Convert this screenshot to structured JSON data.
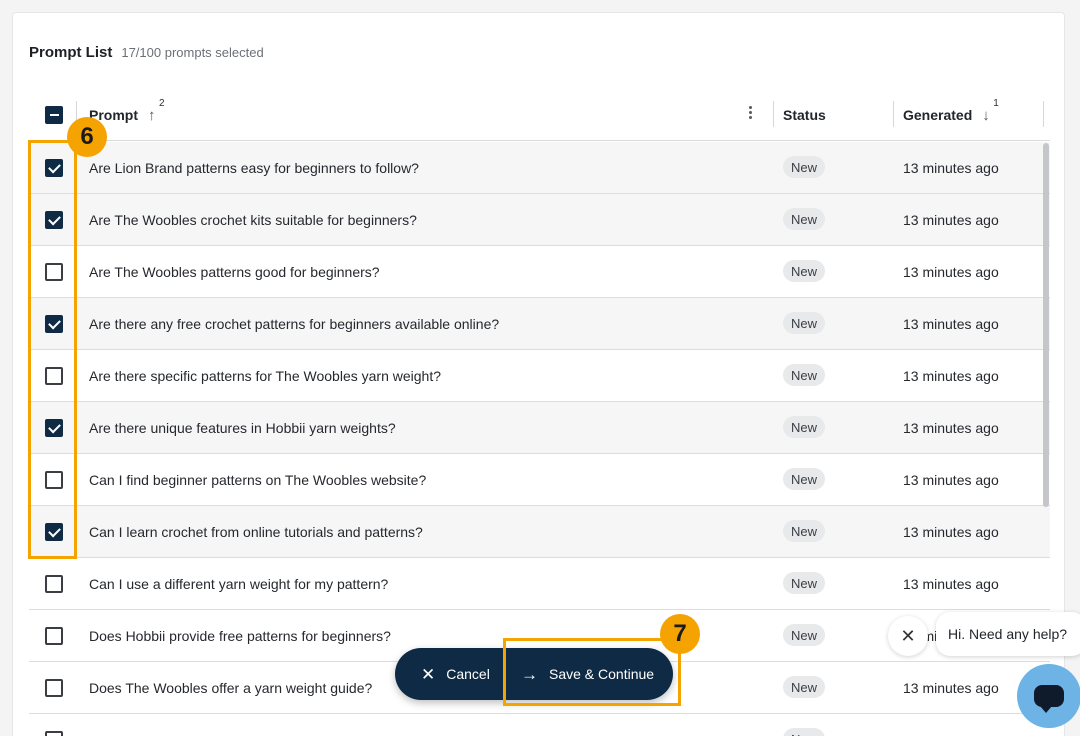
{
  "prompt_list": {
    "title": "Prompt List",
    "selected_count": "17/100 prompts selected"
  },
  "columns": {
    "prompt": "Prompt",
    "prompt_sort_order": "2",
    "status": "Status",
    "generated": "Generated",
    "generated_sort_order": "1"
  },
  "rows": [
    {
      "prompt": "Are Lion Brand patterns easy for beginners to follow?",
      "status": "New",
      "generated": "13 minutes ago",
      "checked": true
    },
    {
      "prompt": "Are The Woobles crochet kits suitable for beginners?",
      "status": "New",
      "generated": "13 minutes ago",
      "checked": true
    },
    {
      "prompt": "Are The Woobles patterns good for beginners?",
      "status": "New",
      "generated": "13 minutes ago",
      "checked": false
    },
    {
      "prompt": "Are there any free crochet patterns for beginners available online?",
      "status": "New",
      "generated": "13 minutes ago",
      "checked": true
    },
    {
      "prompt": "Are there specific patterns for The Woobles yarn weight?",
      "status": "New",
      "generated": "13 minutes ago",
      "checked": false
    },
    {
      "prompt": "Are there unique features in Hobbii yarn weights?",
      "status": "New",
      "generated": "13 minutes ago",
      "checked": true
    },
    {
      "prompt": "Can I find beginner patterns on The Woobles website?",
      "status": "New",
      "generated": "13 minutes ago",
      "checked": false
    },
    {
      "prompt": "Can I learn crochet from online tutorials and patterns?",
      "status": "New",
      "generated": "13 minutes ago",
      "checked": true
    },
    {
      "prompt": "Can I use a different yarn weight for my pattern?",
      "status": "New",
      "generated": "13 minutes ago",
      "checked": false
    },
    {
      "prompt": "Does Hobbii provide free patterns for beginners?",
      "status": "New",
      "generated": "13 minutes ago",
      "checked": false
    },
    {
      "prompt": "Does The Woobles offer a yarn weight guide?",
      "status": "New",
      "generated": "13 minutes ago",
      "checked": false
    },
    {
      "prompt": "",
      "status": "New",
      "generated": "",
      "checked": false
    }
  ],
  "annotations": {
    "step_6": "6",
    "step_7": "7",
    "highlight_color": "#f4a300"
  },
  "actions": {
    "cancel": "Cancel",
    "save": "Save & Continue"
  },
  "chat": {
    "greeting": "Hi. Need any help?"
  },
  "colors": {
    "primary": "#0e2a44",
    "accent": "#f4a300",
    "chat_launcher": "#6eb3e6"
  }
}
